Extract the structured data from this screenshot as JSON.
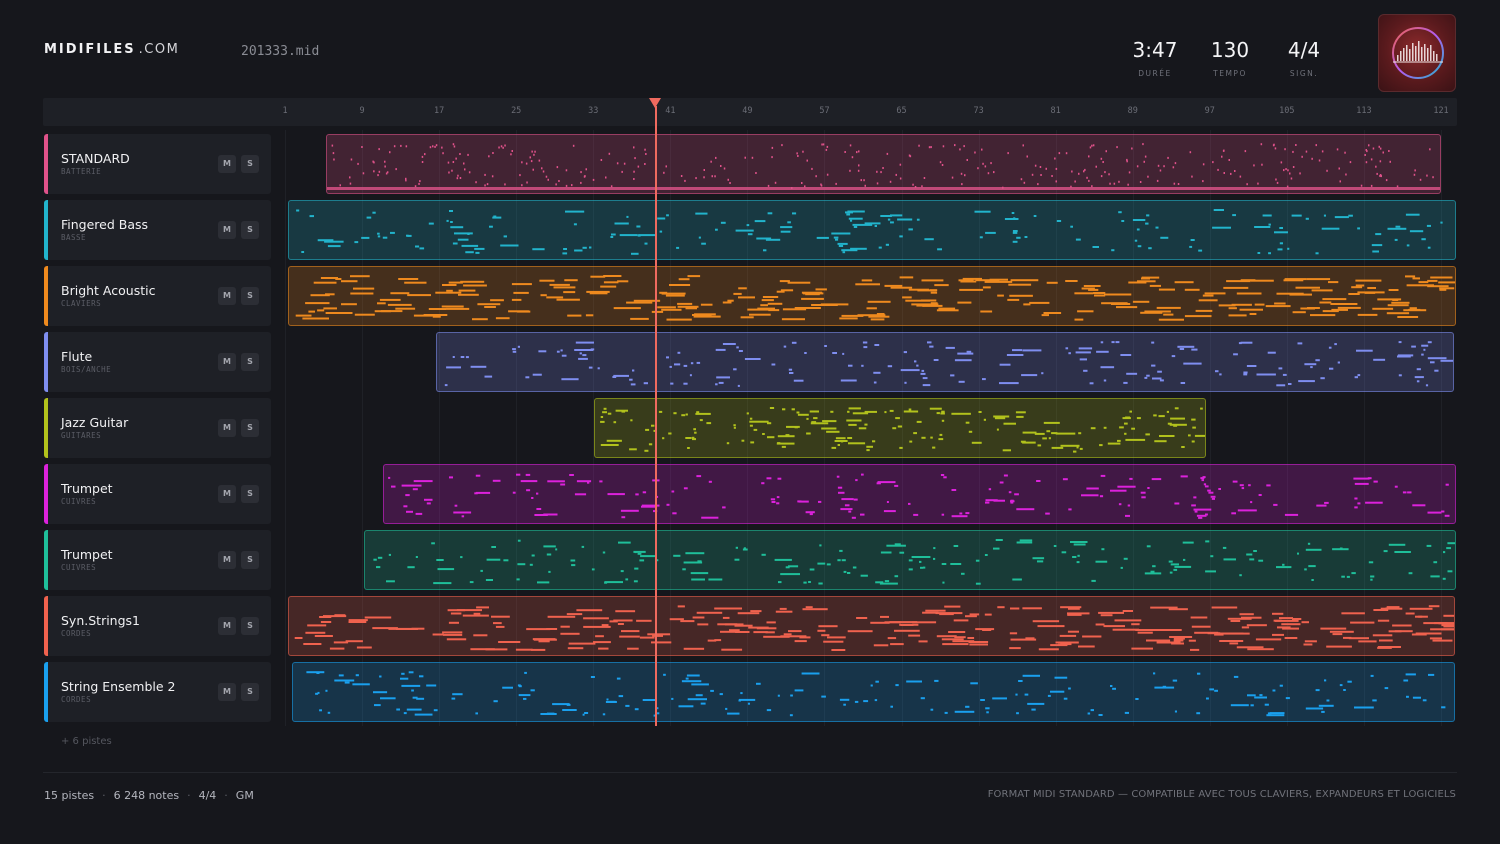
{
  "header": {
    "logo_bold": "MIDIFILES",
    "logo_light": ".COM",
    "filename": "201333.mid",
    "stats": [
      {
        "value": "3:47",
        "label": "DURÉE"
      },
      {
        "value": "130",
        "label": "TEMPO"
      },
      {
        "value": "4/4",
        "label": "SIGN."
      }
    ]
  },
  "ruler": {
    "bars": [
      "1",
      "9",
      "17",
      "25",
      "33",
      "41",
      "49",
      "57",
      "65",
      "73",
      "81",
      "89",
      "97",
      "105",
      "113",
      "121"
    ],
    "playhead_bar": 39
  },
  "tracks": [
    {
      "name": "STANDARD",
      "category": "BATTERIE",
      "color": "#e0528a",
      "mute": "M",
      "solo": "S"
    },
    {
      "name": "Fingered Bass",
      "category": "BASSE",
      "color": "#22b4cc",
      "mute": "M",
      "solo": "S"
    },
    {
      "name": "Bright Acoustic",
      "category": "CLAVIERS",
      "color": "#ef8a1e",
      "mute": "M",
      "solo": "S"
    },
    {
      "name": "Flute",
      "category": "BOIS/ANCHE",
      "color": "#7f8ef0",
      "mute": "M",
      "solo": "S"
    },
    {
      "name": "Jazz Guitar",
      "category": "GUITARES",
      "color": "#b2c21c",
      "mute": "M",
      "solo": "S"
    },
    {
      "name": "Trumpet",
      "category": "CUIVRES",
      "color": "#dc22dc",
      "mute": "M",
      "solo": "S"
    },
    {
      "name": "Trumpet",
      "category": "CUIVRES",
      "color": "#1fbf9a",
      "mute": "M",
      "solo": "S"
    },
    {
      "name": "Syn.Strings1",
      "category": "CORDES",
      "color": "#f0624e",
      "mute": "M",
      "solo": "S"
    },
    {
      "name": "String Ensemble 2",
      "category": "CORDES",
      "color": "#1aa0ee",
      "mute": "M",
      "solo": "S"
    }
  ],
  "more_tracks": "+ 6 pistes",
  "footer": {
    "tracks": "15 pistes",
    "notes": "6 248 notes",
    "signature": "4/4",
    "standard": "GM",
    "tagline": "FORMAT MIDI STANDARD — COMPATIBLE AVEC TOUS CLAVIERS, EXPANDEURS ET LOGICIELS"
  }
}
